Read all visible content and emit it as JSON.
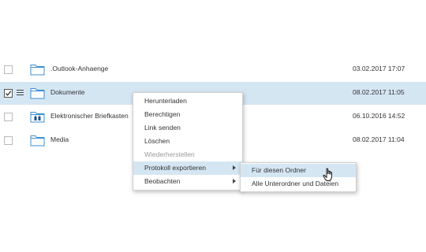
{
  "files": [
    {
      "name": ".Outlook-Anhaenge",
      "date": "03.02.2017 17:07",
      "icon": "folder-icon"
    },
    {
      "name": "Dokumente",
      "date": "08.02.2017 11:05",
      "icon": "folder-icon"
    },
    {
      "name": "Elektronischer Briefkasten",
      "date": "06.10.2016 14:52",
      "icon": "mailbox-folder-icon"
    },
    {
      "name": "Media",
      "date": "08.02.2017 11:04",
      "icon": "folder-icon"
    }
  ],
  "context_menu": {
    "items": [
      {
        "label": "Herunterladen"
      },
      {
        "label": "Berechtigen"
      },
      {
        "label": "Link senden"
      },
      {
        "label": "Löschen"
      },
      {
        "label": "Wiederherstellen",
        "disabled": true
      },
      {
        "label": "Protokoll exportieren",
        "submenu": true,
        "active": true
      },
      {
        "label": "Beobachten",
        "submenu": true
      }
    ]
  },
  "submenu": {
    "items": [
      {
        "label": "Für diesen Ordner",
        "active": true
      },
      {
        "label": "Alle Unterordner und Dateien"
      }
    ]
  },
  "colors": {
    "selection": "#d5e6f3",
    "folder_stroke": "#3d8fd1"
  }
}
